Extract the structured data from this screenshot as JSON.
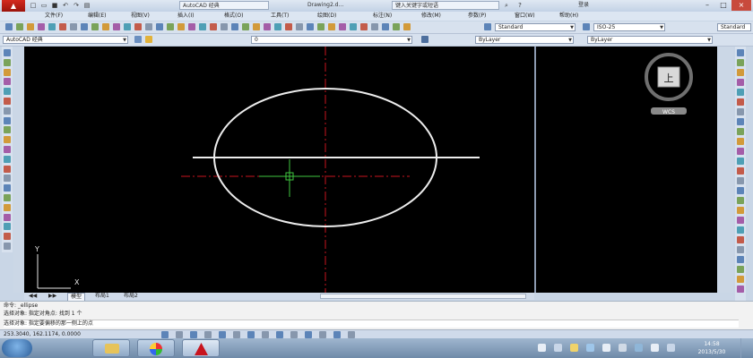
{
  "titlebar": {
    "quick_access_icons": [
      "new-icon",
      "open-icon",
      "save-icon",
      "undo-icon",
      "redo-icon",
      "print-icon"
    ],
    "workspace": "AutoCAD 经典",
    "document": "Drawing2.d…",
    "search_placeholder": "键入关键字或短语",
    "user": "登录"
  },
  "menubar": {
    "items": [
      "文件(F)",
      "编辑(E)",
      "视图(V)",
      "插入(I)",
      "格式(O)",
      "工具(T)",
      "绘图(D)",
      "标注(N)",
      "修改(M)",
      "参数(P)",
      "窗口(W)",
      "帮助(H)"
    ]
  },
  "toolbar2": {
    "text_style": "Standard",
    "dim_style": "ISO-25",
    "right_style": "Standard"
  },
  "toolbar3": {
    "workspace": "AutoCAD 经典",
    "layer": "0",
    "color": "ByLayer",
    "linetype": "ByLayer"
  },
  "viewcube": {
    "face": "上",
    "wcs": "WCS"
  },
  "layout_tabs": [
    "模型",
    "布局1",
    "布局2"
  ],
  "command": {
    "line1": "命令: _ellipse",
    "line2": "选择对象: 指定对角点: 找到 1 个",
    "line3": "选择对象: 指定要偏移的那一侧上的点"
  },
  "status": {
    "coords": "253.3040, 162.1174, 0.0000"
  },
  "clock": {
    "time": "14:58",
    "date": "2013/5/30"
  },
  "colors": {
    "canvas": "#000000",
    "centerline": "#c8141e",
    "geometry": "#ffffff",
    "cursor": "#3fc63f"
  }
}
